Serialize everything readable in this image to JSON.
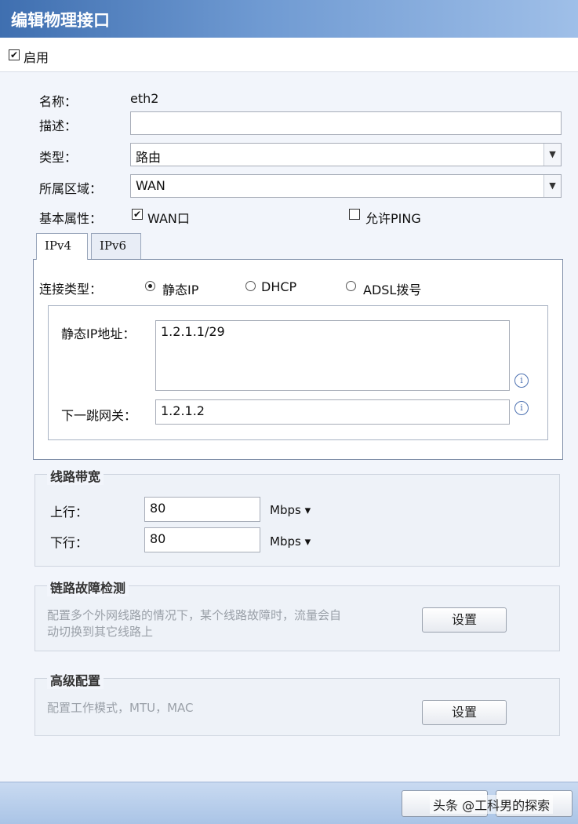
{
  "dialog": {
    "title": "编辑物理接口"
  },
  "enable": {
    "checked": true,
    "label": "启用"
  },
  "form": {
    "name": {
      "label": "名称：",
      "value": "eth2"
    },
    "desc": {
      "label": "描述：",
      "value": ""
    },
    "type": {
      "label": "类型：",
      "value": "路由"
    },
    "zone": {
      "label": "所属区域：",
      "value": "WAN"
    },
    "attrs": {
      "label": "基本属性：",
      "wan": {
        "label": "WAN口",
        "checked": true
      },
      "ping": {
        "label": "允许PING",
        "checked": false
      }
    }
  },
  "tabs": [
    {
      "label": "IPv4",
      "active": true
    },
    {
      "label": "IPv6",
      "active": false
    }
  ],
  "ipv4": {
    "conn_label": "连接类型：",
    "options": [
      {
        "label": "静态IP",
        "selected": true
      },
      {
        "label": "DHCP",
        "selected": false
      },
      {
        "label": "ADSL拨号",
        "selected": false
      }
    ],
    "static_ip": {
      "label": "静态IP地址：",
      "value": "1.2.1.1/29"
    },
    "gateway": {
      "label": "下一跳网关：",
      "value": "1.2.1.2"
    }
  },
  "bandwidth": {
    "title": "线路带宽",
    "up": {
      "label": "上行：",
      "value": "80",
      "unit": "Mbps ▾"
    },
    "down": {
      "label": "下行：",
      "value": "80",
      "unit": "Mbps ▾"
    }
  },
  "fault": {
    "title": "链路故障检测",
    "desc_line1": "配置多个外网线路的情况下，某个线路故障时，流量会自",
    "desc_line2": "动切换到其它线路上",
    "button": "设置"
  },
  "advanced": {
    "title": "高级配置",
    "desc": "配置工作模式，MTU，MAC",
    "button": "设置"
  },
  "footer": {
    "watermark": "头条 @工科男的探索"
  }
}
